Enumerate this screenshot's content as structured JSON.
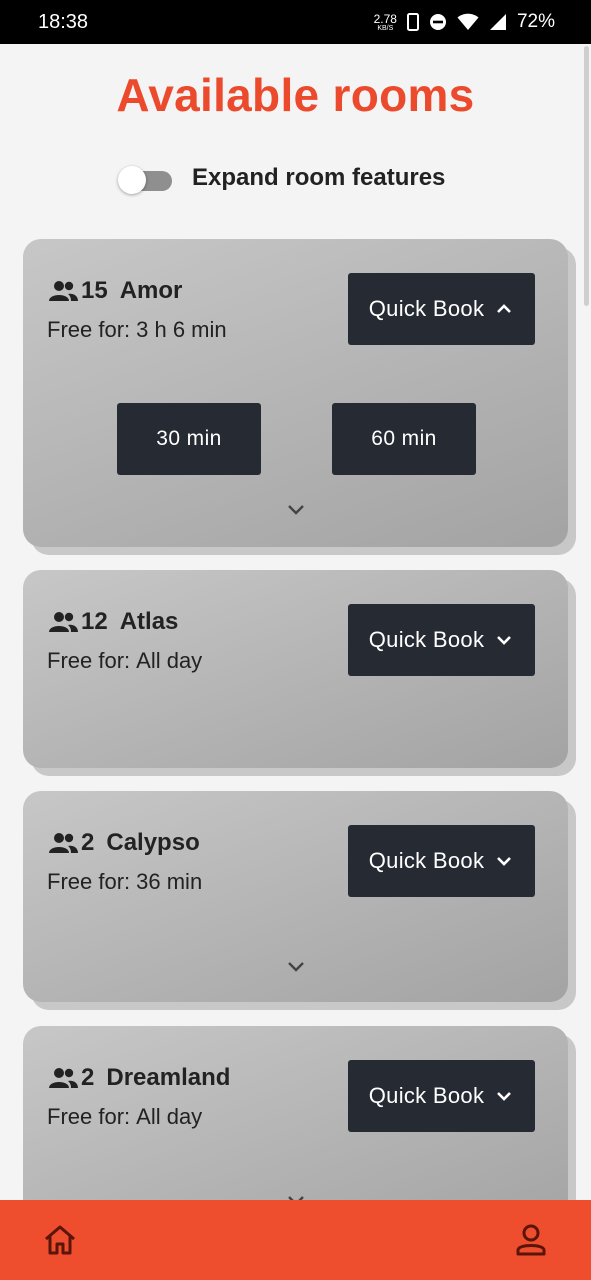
{
  "status_bar": {
    "time": "18:38",
    "net_speed_value": "2.78",
    "net_speed_unit": "KB/S",
    "battery": "72%",
    "icons": [
      "phone-icon",
      "do-not-disturb-icon",
      "wifi-icon",
      "signal-icon"
    ]
  },
  "page": {
    "title": "Available rooms",
    "toggle_label": "Expand room features",
    "toggle_on": false
  },
  "free_label": "Free for:",
  "rooms": [
    {
      "capacity": "15",
      "name": "Amor",
      "free_for": "3 h 6 min",
      "quick_book": "Quick Book",
      "expanded": true,
      "durations": [
        "30 min",
        "60 min"
      ]
    },
    {
      "capacity": "12",
      "name": "Atlas",
      "free_for": "All day",
      "quick_book": "Quick Book",
      "expanded": false
    },
    {
      "capacity": "2",
      "name": "Calypso",
      "free_for": "36 min",
      "quick_book": "Quick Book",
      "expanded": false
    },
    {
      "capacity": "2",
      "name": "Dreamland",
      "free_for": "All day",
      "quick_book": "Quick Book",
      "expanded": false
    }
  ],
  "bottom_nav": {
    "items": [
      "home-icon",
      "profile-icon"
    ],
    "background": "#ee4e2e"
  },
  "colors": {
    "accent": "#ec4a2c",
    "button": "#262a33"
  }
}
